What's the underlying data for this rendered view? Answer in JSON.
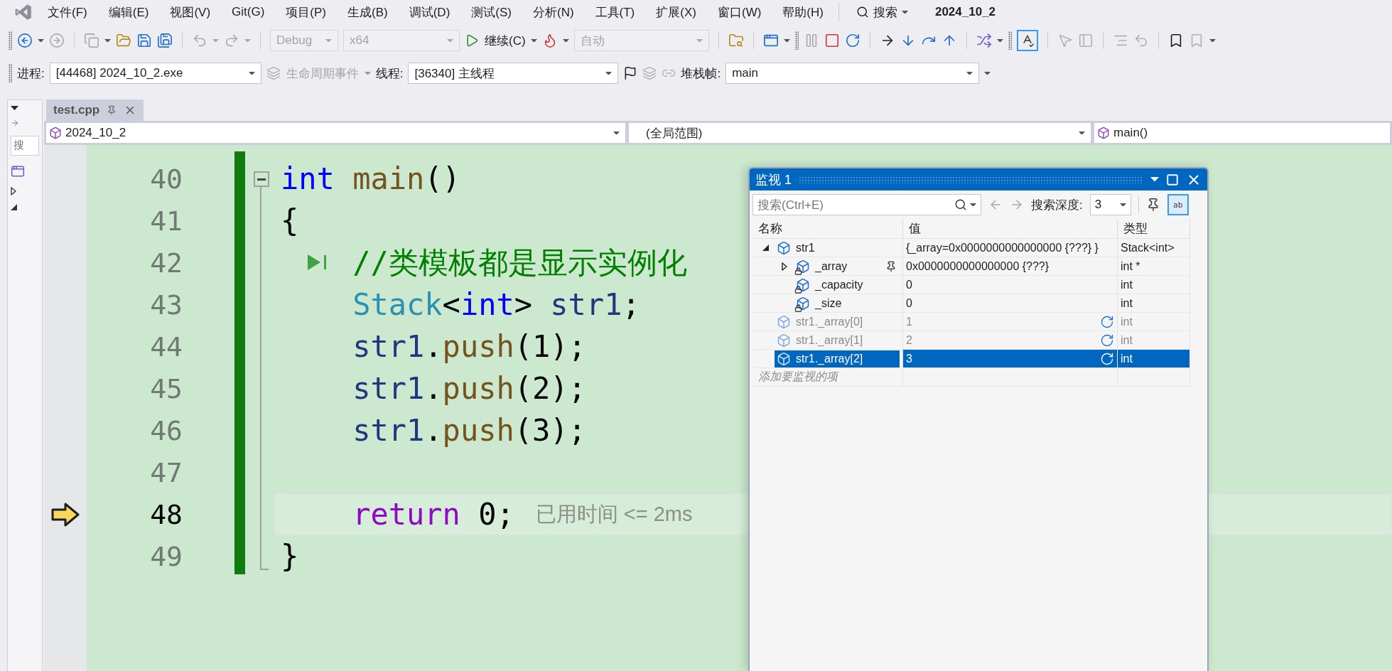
{
  "menu": [
    "文件(F)",
    "编辑(E)",
    "视图(V)",
    "Git(G)",
    "项目(P)",
    "生成(B)",
    "调试(D)",
    "测试(S)",
    "分析(N)",
    "工具(T)",
    "扩展(X)",
    "窗口(W)",
    "帮助(H)"
  ],
  "search": {
    "label": "搜索"
  },
  "solution_name": "2024_10_2",
  "toolbar": {
    "configuration": {
      "value": "Debug",
      "disabled": true
    },
    "platform": {
      "value": "x64",
      "disabled": true
    },
    "continue": "继续(C)",
    "code_type": {
      "value": "自动",
      "disabled": true
    }
  },
  "debug_location": {
    "process_label": "进程:",
    "process": "[44468] 2024_10_2.exe",
    "lifecycle": {
      "label": "生命周期事件",
      "disabled": true
    },
    "thread_label": "线程:",
    "thread": "[36340] 主线程",
    "stack_label": "堆栈帧:",
    "stack_frame": "main"
  },
  "left_panel": {
    "search_placeholder": "搜"
  },
  "tabs": [
    {
      "label": "test.cpp",
      "selected": true
    }
  ],
  "nav_bar": {
    "project": "2024_10_2",
    "scope": "(全局范围)",
    "member": "main()"
  },
  "editor": {
    "changed": true,
    "outlining": {
      "expanded": true
    },
    "lines": [
      {
        "number": "40",
        "current": false,
        "run_glyph": false,
        "tokens": [
          {
            "text": "int",
            "kind": "keyword"
          },
          {
            "text": " main",
            "kind": "function"
          },
          {
            "text": "()",
            "kind": "punct"
          }
        ]
      },
      {
        "number": "41",
        "current": false,
        "run_glyph": false,
        "tokens": [
          {
            "text": "{",
            "kind": "punct"
          }
        ]
      },
      {
        "number": "42",
        "current": false,
        "run_glyph": true,
        "tokens": [
          {
            "text": "    //类模板都是显示实例化",
            "kind": "comment"
          }
        ]
      },
      {
        "number": "43",
        "current": false,
        "run_glyph": false,
        "tokens": [
          {
            "text": "    Stack",
            "kind": "type"
          },
          {
            "text": "<",
            "kind": "punct"
          },
          {
            "text": "int",
            "kind": "keyword"
          },
          {
            "text": "> ",
            "kind": "punct"
          },
          {
            "text": "str1",
            "kind": "variable"
          },
          {
            "text": ";",
            "kind": "punct"
          }
        ]
      },
      {
        "number": "44",
        "current": false,
        "run_glyph": false,
        "tokens": [
          {
            "text": "    str1",
            "kind": "variable"
          },
          {
            "text": ".",
            "kind": "punct"
          },
          {
            "text": "push",
            "kind": "function"
          },
          {
            "text": "(1);",
            "kind": "punct"
          }
        ]
      },
      {
        "number": "45",
        "current": false,
        "run_glyph": false,
        "tokens": [
          {
            "text": "    str1",
            "kind": "variable"
          },
          {
            "text": ".",
            "kind": "punct"
          },
          {
            "text": "push",
            "kind": "function"
          },
          {
            "text": "(2);",
            "kind": "punct"
          }
        ]
      },
      {
        "number": "46",
        "current": false,
        "run_glyph": false,
        "tokens": [
          {
            "text": "    str1",
            "kind": "variable"
          },
          {
            "text": ".",
            "kind": "punct"
          },
          {
            "text": "push",
            "kind": "function"
          },
          {
            "text": "(3);",
            "kind": "punct"
          }
        ]
      },
      {
        "number": "47",
        "current": false,
        "run_glyph": false
      },
      {
        "number": "48",
        "current": true,
        "run_glyph": false,
        "tokens": [
          {
            "text": "    return",
            "kind": "control"
          },
          {
            "text": " 0;",
            "kind": "punct"
          }
        ],
        "hint": "已用时间 <= 2ms"
      },
      {
        "number": "49",
        "current": false,
        "run_glyph": false,
        "tokens": [
          {
            "text": "}",
            "kind": "punct"
          }
        ]
      }
    ]
  },
  "watch": {
    "title": "监视 1",
    "search_placeholder": "搜索(Ctrl+E)",
    "depth_label": "搜索深度:",
    "depth": "3",
    "toggle_label": "ab",
    "columns": [
      "名称",
      "值",
      "类型"
    ],
    "rows": [
      {
        "name": "str1",
        "value": "{_array=0x0000000000000000 {???} }",
        "type": "Stack<int>",
        "kind": "object",
        "expanded": true,
        "stale": false,
        "selected": false,
        "pin_shown": false,
        "children": [
          {
            "name": "_array",
            "value": "0x0000000000000000 {???}",
            "type": "int *",
            "kind": "private",
            "expanded": false,
            "stale": false,
            "selected": false,
            "pin_shown": true
          },
          {
            "name": "_capacity",
            "value": "0",
            "type": "int",
            "kind": "private",
            "stale": false,
            "selected": false,
            "pin_shown": false
          },
          {
            "name": "_size",
            "value": "0",
            "type": "int",
            "kind": "private",
            "stale": false,
            "selected": false,
            "pin_shown": false
          }
        ]
      },
      {
        "name": "str1._array[0]",
        "value": "1",
        "type": "int",
        "kind": "object",
        "stale": true,
        "selected": false,
        "pin_shown": false
      },
      {
        "name": "str1._array[1]",
        "value": "2",
        "type": "int",
        "kind": "object",
        "stale": true,
        "selected": false,
        "pin_shown": false
      },
      {
        "name": "str1._array[2]",
        "value": "3",
        "type": "int",
        "kind": "object",
        "stale": true,
        "selected": true,
        "pin_shown": false
      }
    ],
    "add_placeholder": "添加要监视的项"
  }
}
